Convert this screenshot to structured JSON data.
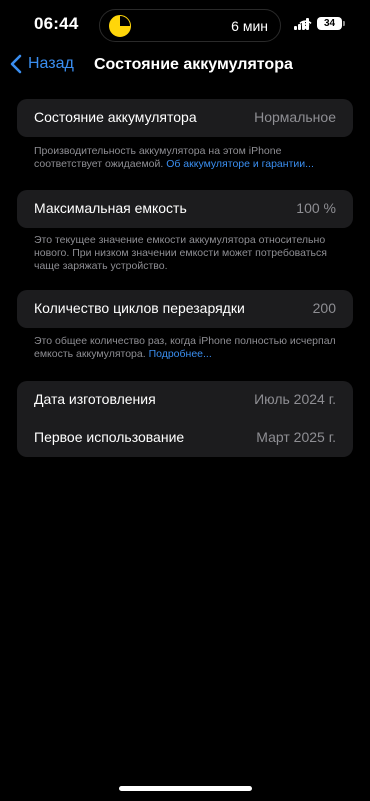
{
  "status_bar": {
    "time": "06:44",
    "island_text": "6 мин",
    "battery_level": "34"
  },
  "nav": {
    "back_label": "Назад",
    "title": "Состояние аккумулятора"
  },
  "health": {
    "label": "Состояние аккумулятора",
    "value": "Нормальное",
    "note": "Производительность аккумулятора на этом iPhone соответствует ожидаемой.",
    "link": "Об аккумуляторе и гарантии..."
  },
  "capacity": {
    "label": "Максимальная емкость",
    "value": "100 %",
    "note": "Это текущее значение емкости аккумулятора относительно нового. При низком значении емкости может потребоваться чаще заряжать устройство."
  },
  "cycles": {
    "label": "Количество циклов перезарядки",
    "value": "200",
    "note": "Это общее количество раз, когда iPhone полностью исчерпал емкость аккумулятора.",
    "link": "Подробнее..."
  },
  "dates": {
    "manufacture_label": "Дата изготовления",
    "manufacture_value": "Июль 2024 г.",
    "first_use_label": "Первое использование",
    "first_use_value": "Март 2025 г."
  },
  "colors": {
    "accent": "#3a8ef0",
    "card_bg": "#1c1c1e",
    "secondary_text": "#8e8e93"
  }
}
